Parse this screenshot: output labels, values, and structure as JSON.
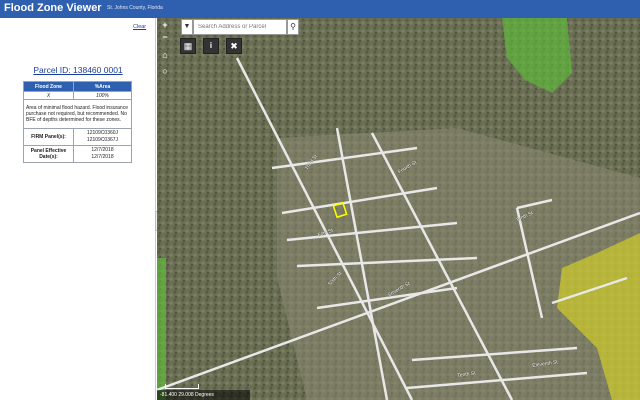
{
  "header": {
    "title": "Flood Zone Viewer",
    "subtitle": "St. Johns County, Florida",
    "color": "#2f5faf"
  },
  "sidebar": {
    "clear_label": "Clear",
    "parcel_title": "Parcel ID: 138460 0001",
    "table": {
      "col_zone": "Flood Zone",
      "col_area": "%Area",
      "zone_value": "X",
      "area_value": "100%",
      "description": "Area of minimal flood hazard. Flood insurance purchase not required, but recommended. No BFE of depths determined for these zones.",
      "firm_label": "FIRM Panel(s):",
      "firm_value_1": "12109C0360J",
      "firm_value_2": "12109C0367J",
      "effective_label": "Panel Effective Date(s):",
      "effective_value_1": "12/7/2018",
      "effective_value_2": "12/7/2018"
    }
  },
  "map": {
    "search_placeholder": "Search Address or Parcel",
    "coordinates": "-81.400 29.008 Degrees",
    "icons": {
      "zoom_in": "plus-icon",
      "zoom_out": "minus-icon",
      "home": "home-icon",
      "locate": "locate-icon",
      "dropdown": "caret-down-icon",
      "search": "search-icon",
      "basemap": "grid-icon",
      "info": "info-icon",
      "measure": "ruler-icon"
    },
    "street_labels": [
      "Third St",
      "Fourth St",
      "Fifth St",
      "Sixth St",
      "Seventh St",
      "Tenth St",
      "Eleventh St",
      "Tenth St"
    ],
    "colors": {
      "flood_zone_green": "#5fbf3a",
      "flood_zone_yellow": "#e8e41a",
      "road": "#e8e8e8",
      "parcel_highlight": "#ffff00"
    }
  }
}
